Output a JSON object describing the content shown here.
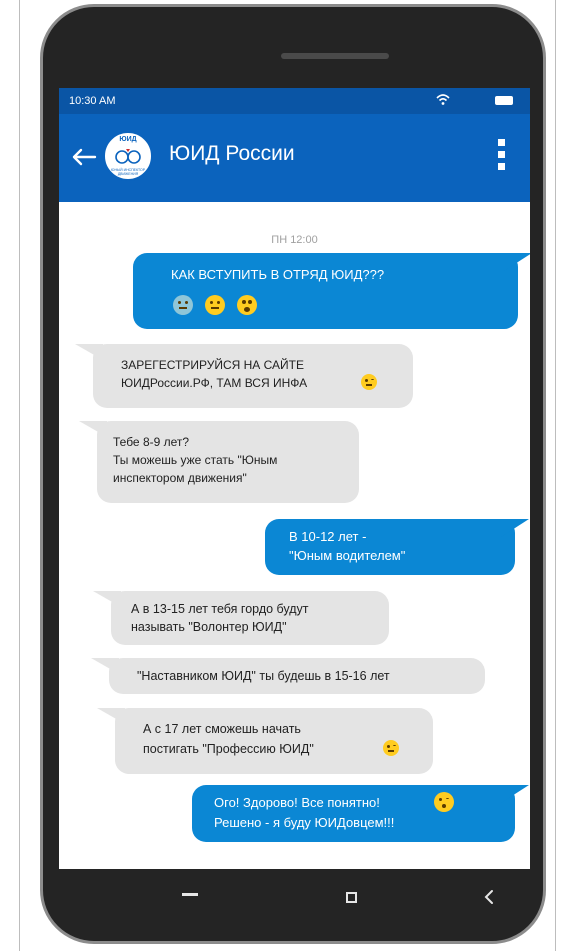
{
  "status_bar": {
    "time": "10:30 AM"
  },
  "app_bar": {
    "title": "ЮИД России",
    "logo_text": "ЮИД",
    "logo_subtext": "ЮНЫЙ ИНСПЕКТОР ДВИЖЕНИЯ"
  },
  "chat": {
    "timestamp": "ПН 12:00",
    "messages": [
      {
        "direction": "out",
        "lines": [
          "КАК ВСТУПИТЬ В ОТРЯД ЮИД???"
        ],
        "emojis": [
          "anxious-face",
          "neutral-face",
          "astonished-face"
        ]
      },
      {
        "direction": "in",
        "lines": [
          "ЗАРЕГЕСТРИРУЙСЯ НА САЙТЕ",
          "ЮИДРоссии.РФ, ТАМ ВСЯ ИНФА"
        ],
        "emojis": [
          "winking-face"
        ]
      },
      {
        "direction": "in",
        "lines": [
          "Тебе 8-9 лет?",
          "Ты можешь уже стать \"Юным",
          "инспектором движения\""
        ]
      },
      {
        "direction": "out",
        "lines": [
          "В 10-12 лет -",
          "\"Юным водителем\""
        ]
      },
      {
        "direction": "in",
        "lines": [
          "А в 13-15 лет тебя гордо будут",
          "называть \"Волонтер ЮИД\""
        ]
      },
      {
        "direction": "in",
        "lines": [
          "\"Наставником ЮИД\" ты будешь в 15-16 лет"
        ]
      },
      {
        "direction": "in",
        "lines": [
          "А с 17 лет сможешь начать",
          "постигать \"Профессию ЮИД\""
        ],
        "emojis": [
          "winking-face"
        ]
      },
      {
        "direction": "out",
        "lines": [
          "Ого! Здорово! Все понятно!",
          "Решено - я буду ЮИДовцем!!!"
        ],
        "emojis": [
          "kissing-face"
        ]
      }
    ]
  },
  "colors": {
    "status_bar": "#0a55a5",
    "app_bar": "#0b63bd",
    "outgoing_bubble": "#0b87d4",
    "incoming_bubble": "#e4e4e4",
    "emoji": "#ffcc20"
  }
}
